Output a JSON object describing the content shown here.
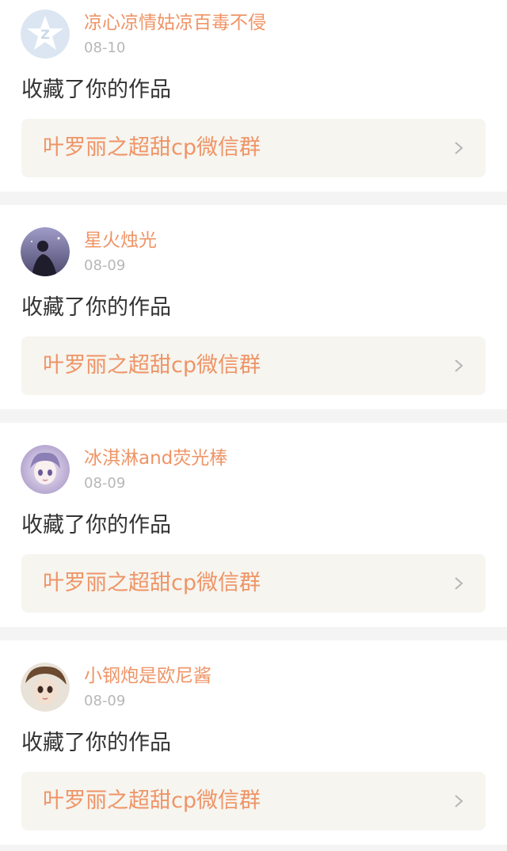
{
  "colors": {
    "accent": "#ef9466",
    "date": "#b7b7b7",
    "text": "#333333",
    "box_bg": "#f6f5f0",
    "divider": "#f5f4f4"
  },
  "notifications": [
    {
      "username": "凉心凉情姑凉百毒不侵",
      "date": "08-10",
      "action": "收藏了你的作品",
      "work_title": "叶罗丽之超甜cp微信群",
      "avatar": "qq-default-avatar-icon"
    },
    {
      "username": "星火烛光",
      "date": "08-09",
      "action": "收藏了你的作品",
      "work_title": "叶罗丽之超甜cp微信群",
      "avatar": "night-sky-figure-avatar"
    },
    {
      "username": "冰淇淋and荧光棒",
      "date": "08-09",
      "action": "收藏了你的作品",
      "work_title": "叶罗丽之超甜cp微信群",
      "avatar": "anime-girl-avatar"
    },
    {
      "username": "小钢炮是欧尼酱",
      "date": "08-09",
      "action": "收藏了你的作品",
      "work_title": "叶罗丽之超甜cp微信群",
      "avatar": "doll-face-avatar"
    }
  ]
}
